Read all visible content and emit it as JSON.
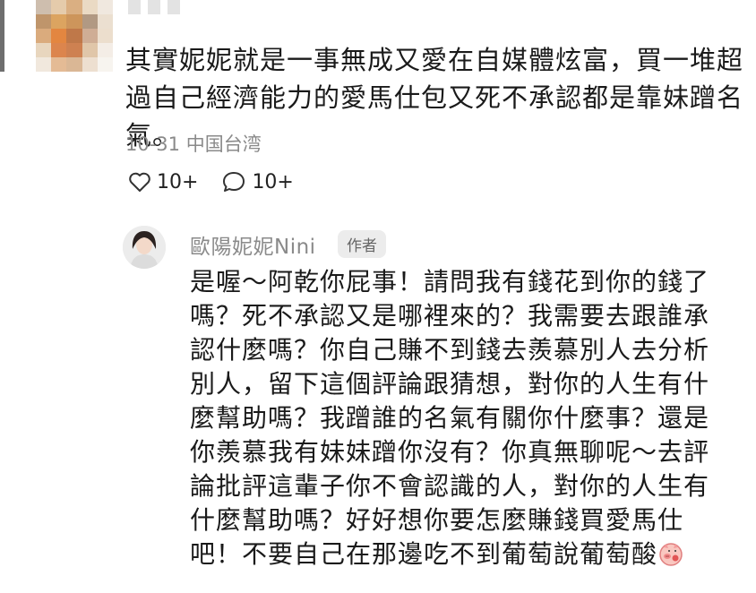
{
  "comment": {
    "text": "其實妮妮就是一事無成又愛在自媒體炫富，買一堆超過自己經濟能力的愛馬仕包又死不承認都是靠妹蹭名氣。",
    "meta": "10-31 中国台湾",
    "likes": "10+",
    "replies": "10+"
  },
  "reply": {
    "author_name": "歐陽妮妮Nini",
    "badge": "作者",
    "text": "是喔～阿乾你屁事！請問我有錢花到你的錢了嗎？死不承認又是哪裡來的？我需要去跟誰承認什麼嗎？你自己賺不到錢去羨慕別人去分析別人，留下這個評論跟猜想，對你的人生有什麼幫助嗎？我蹭誰的名氣有關你什麼事？還是你羨慕我有妹妹蹭你沒有？你真無聊呢～去評論批評這輩子你不會認識的人，對你的人生有什麼幫助嗎？好好想你要怎麼賺錢買愛馬仕吧！不要自己在那邊吃不到葡萄說葡萄酸"
  },
  "icons": {
    "like": "heart-outline-icon",
    "reply": "speech-bubble-icon",
    "emoji": "pig-face-emoji-icon"
  }
}
